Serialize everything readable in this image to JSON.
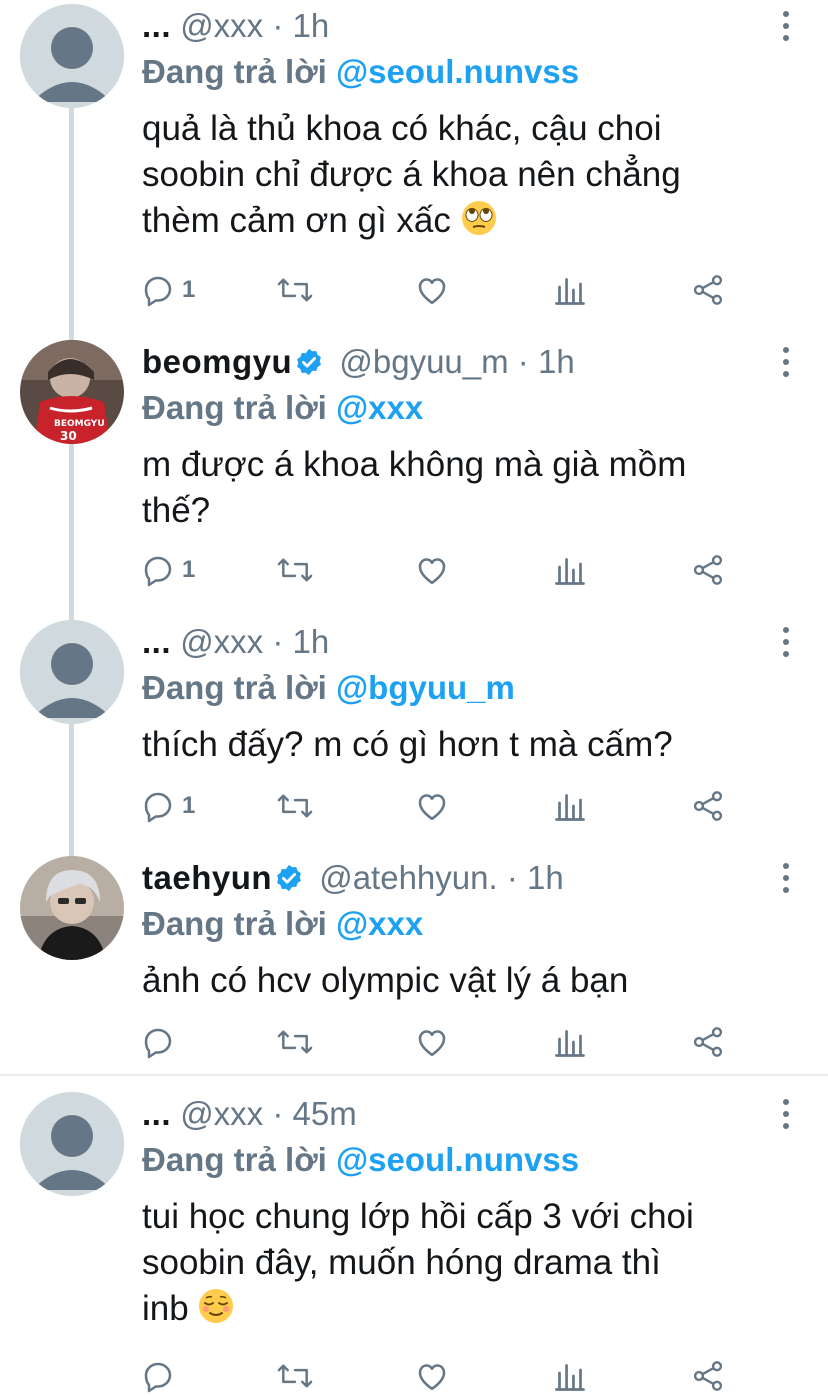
{
  "tweets": [
    {
      "name": "...",
      "verified": false,
      "handle": "@xxx",
      "sep": "·",
      "time": "1h",
      "reply_prefix": "Đang trả lời",
      "reply_to": "@seoul.nunvss",
      "text_lines": [
        "quả là thủ khoa có khác, cậu choi",
        "soobin chỉ được á khoa nên chẳng",
        "thèm cảm ơn gì xấc"
      ],
      "emoji": "eye-roll-emoji",
      "reply_count": "1",
      "avatar": "default-avatar"
    },
    {
      "name": "beomgyu",
      "verified": true,
      "handle": "@bgyuu_m",
      "sep": "·",
      "time": "1h",
      "reply_prefix": "Đang trả lời",
      "reply_to": "@xxx",
      "text_lines": [
        "m được á khoa không mà già mồm",
        "thế?"
      ],
      "reply_count": "1",
      "avatar": "photo-avatar-jersey"
    },
    {
      "name": "...",
      "verified": false,
      "handle": "@xxx",
      "sep": "·",
      "time": "1h",
      "reply_prefix": "Đang trả lời",
      "reply_to": "@bgyuu_m",
      "text_lines": [
        "thích đấy? m có gì hơn t mà cấm?"
      ],
      "reply_count": "1",
      "avatar": "default-avatar"
    },
    {
      "name": "taehyun",
      "verified": true,
      "handle": "@atehhyun.",
      "sep": "·",
      "time": "1h",
      "reply_prefix": "Đang trả lời",
      "reply_to": "@xxx",
      "text_lines": [
        "ảnh có hcv olympic vật lý á bạn"
      ],
      "reply_count": "",
      "avatar": "photo-avatar-silver-hair"
    },
    {
      "name": "...",
      "verified": false,
      "handle": "@xxx",
      "sep": "·",
      "time": "45m",
      "reply_prefix": "Đang trả lời",
      "reply_to": "@seoul.nunvss",
      "text_lines": [
        "tui học chung lớp hồi cấp 3 với choi",
        "soobin đây, muốn hóng drama thì",
        "inb"
      ],
      "emoji": "relieved-face-emoji",
      "reply_count": "",
      "avatar": "default-avatar"
    }
  ],
  "colors": {
    "accent": "#1da1f2",
    "muted": "#657786",
    "text": "#14171a",
    "line": "#cfd9de"
  },
  "icons": [
    "reply-icon",
    "retweet-icon",
    "like-icon",
    "analytics-icon",
    "share-icon",
    "more-options-icon",
    "verified-badge-icon"
  ]
}
